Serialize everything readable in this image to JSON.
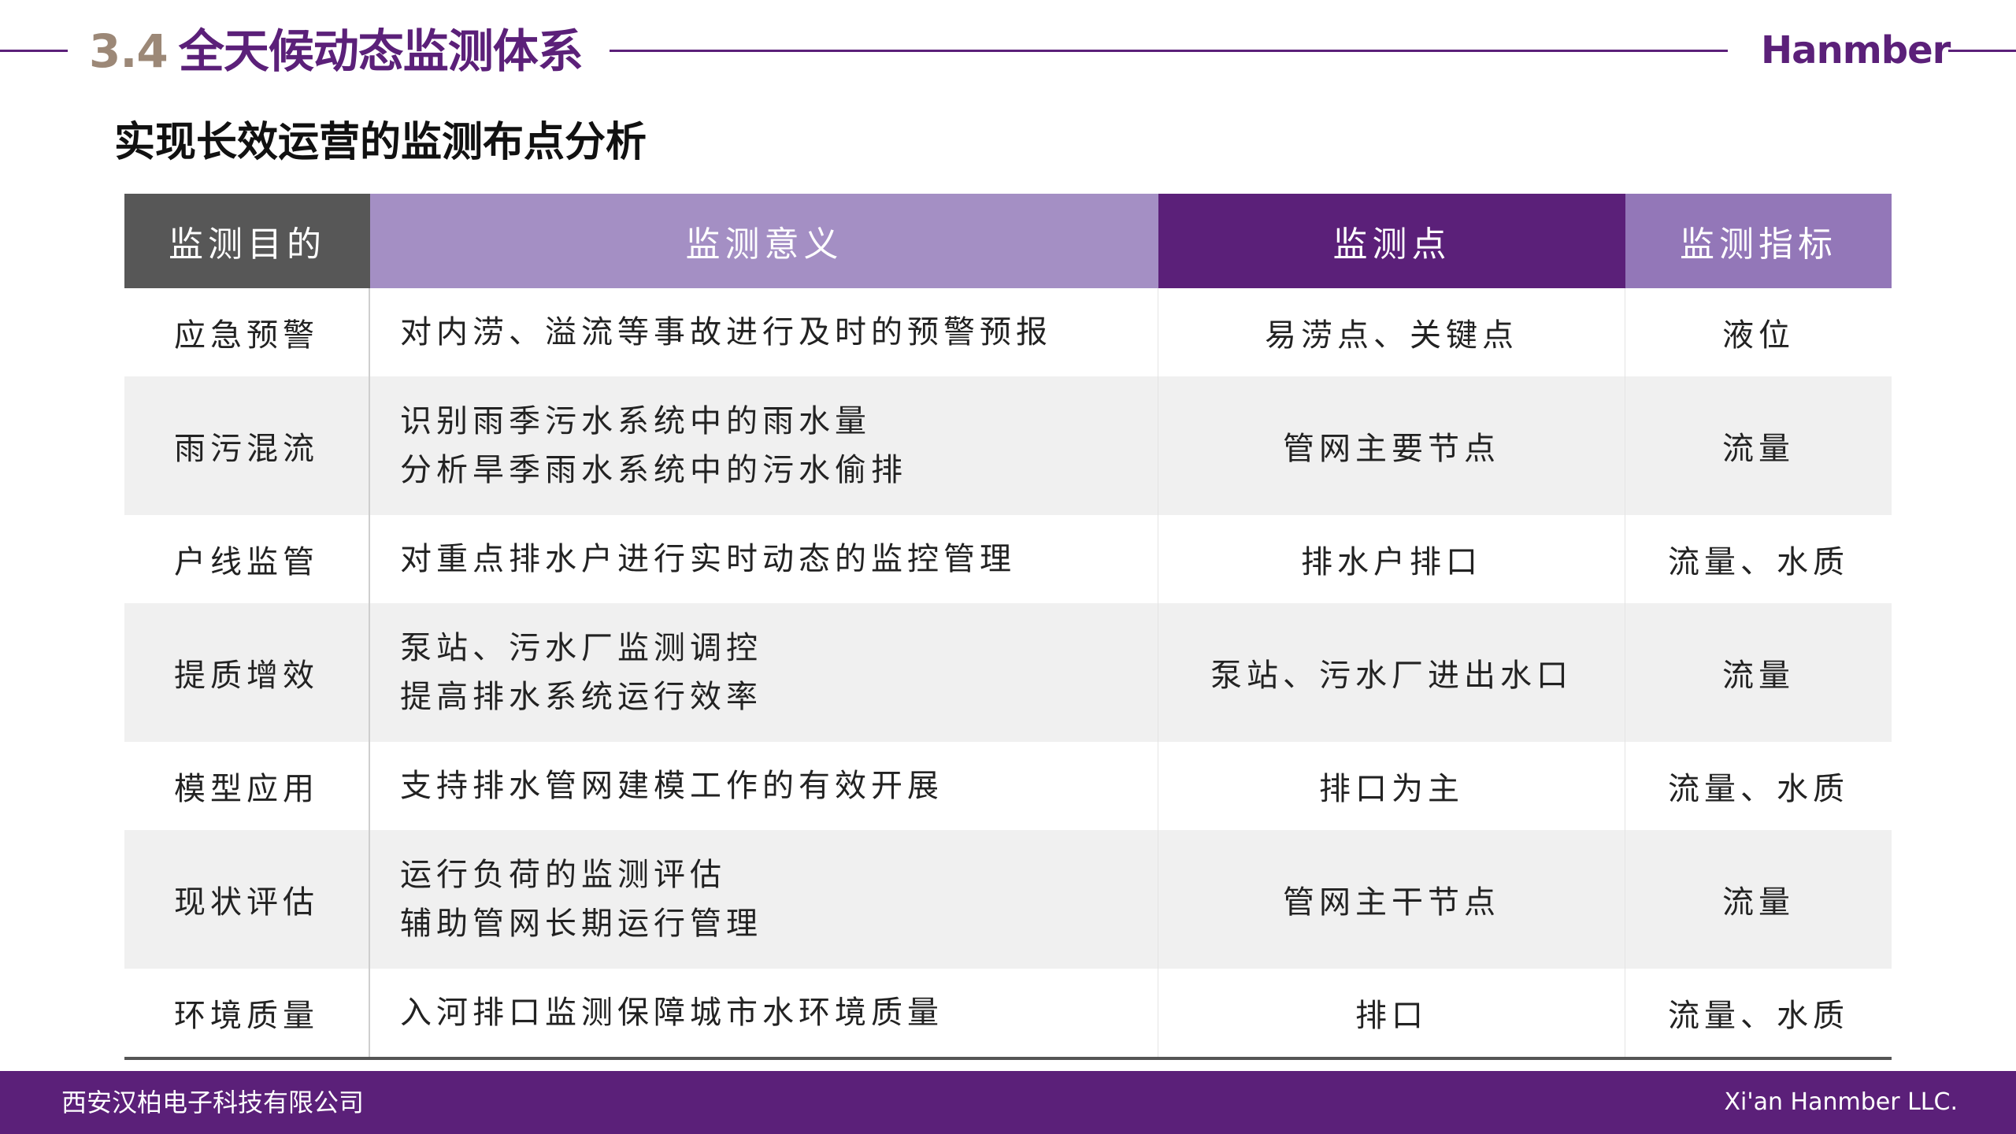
{
  "header": {
    "section_number": "3.4",
    "title": "全天候动态监测体系",
    "brand": "Hanmber"
  },
  "subtitle": "实现长效运营的监测布点分析",
  "table": {
    "columns": [
      "监测目的",
      "监测意义",
      "监测点",
      "监测指标"
    ],
    "rows": [
      {
        "purpose": "应急预警",
        "meaning": [
          "对内涝、溢流等事故进行及时的预警预报"
        ],
        "point": "易涝点、关键点",
        "indicator": "液位"
      },
      {
        "purpose": "雨污混流",
        "meaning": [
          "识别雨季污水系统中的雨水量",
          "分析旱季雨水系统中的污水偷排"
        ],
        "point": "管网主要节点",
        "indicator": "流量"
      },
      {
        "purpose": "户线监管",
        "meaning": [
          "对重点排水户进行实时动态的监控管理"
        ],
        "point": "排水户排口",
        "indicator": "流量、水质"
      },
      {
        "purpose": "提质增效",
        "meaning": [
          "泵站、污水厂监测调控",
          "提高排水系统运行效率"
        ],
        "point": "泵站、污水厂进出水口",
        "indicator": "流量"
      },
      {
        "purpose": "模型应用",
        "meaning": [
          "支持排水管网建模工作的有效开展"
        ],
        "point": "排口为主",
        "indicator": "流量、水质"
      },
      {
        "purpose": "现状评估",
        "meaning": [
          "运行负荷的监测评估",
          "辅助管网长期运行管理"
        ],
        "point": "管网主干节点",
        "indicator": "流量"
      },
      {
        "purpose": "环境质量",
        "meaning": [
          "入河排口监测保障城市水环境质量"
        ],
        "point": "排口",
        "indicator": "流量、水质"
      }
    ]
  },
  "footer": {
    "company_cn": "西安汉柏电子科技有限公司",
    "company_en": "Xi'an Hanmber LLC."
  },
  "colors": {
    "brand_purple": "#5b2079",
    "header_gray": "#575757",
    "header_lavender": "#a48fc4",
    "header_violet": "#9377b8",
    "section_number": "#9c8877"
  }
}
